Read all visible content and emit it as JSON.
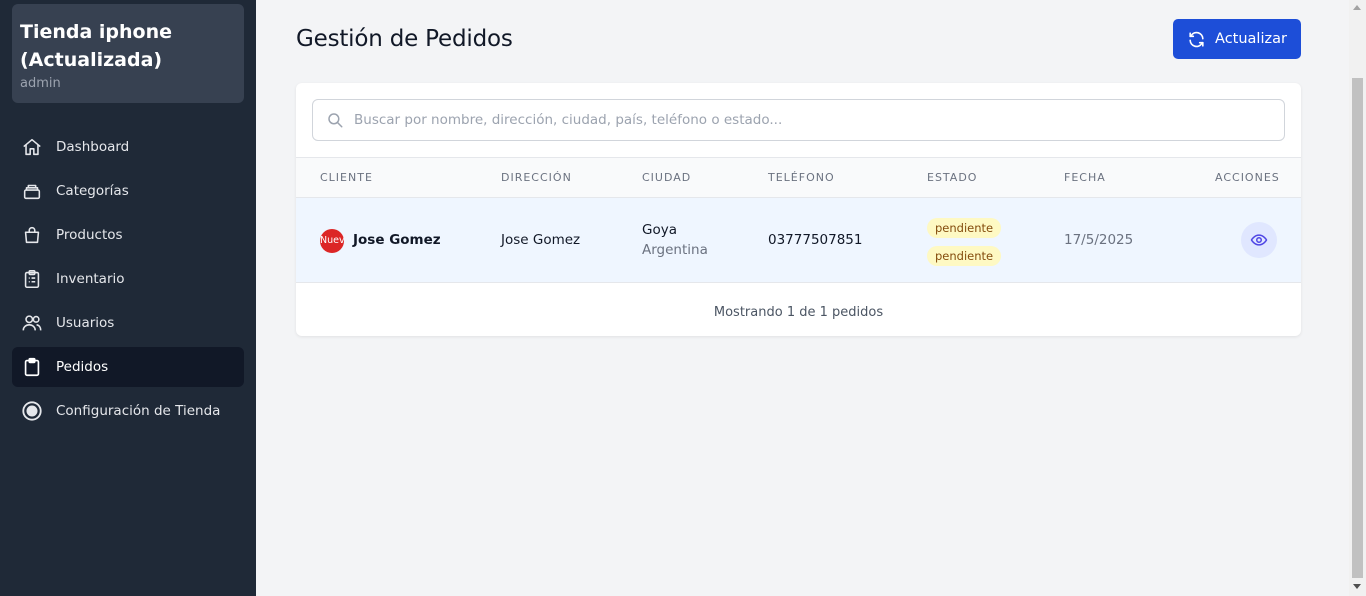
{
  "sidebar": {
    "store_title": "Tienda iphone (Actualizada)",
    "store_role": "admin",
    "items": [
      {
        "label": "Dashboard",
        "icon": "home-icon"
      },
      {
        "label": "Categorías",
        "icon": "layers-icon"
      },
      {
        "label": "Productos",
        "icon": "bag-icon"
      },
      {
        "label": "Inventario",
        "icon": "clipboard-list-icon"
      },
      {
        "label": "Usuarios",
        "icon": "users-icon"
      },
      {
        "label": "Pedidos",
        "icon": "clipboard-icon",
        "active": true
      },
      {
        "label": "Configuración de Tienda",
        "icon": "target-icon"
      }
    ]
  },
  "header": {
    "title": "Gestión de Pedidos",
    "refresh_label": "Actualizar"
  },
  "search": {
    "placeholder": "Buscar por nombre, dirección, ciudad, país, teléfono o estado..."
  },
  "table": {
    "columns": [
      "Cliente",
      "Dirección",
      "Ciudad",
      "Teléfono",
      "Estado",
      "Fecha",
      "Acciones"
    ],
    "rows": [
      {
        "new_badge": "Nuevo",
        "client": "Jose Gomez",
        "address": "Jose Gomez",
        "city": "Goya",
        "country": "Argentina",
        "phone": "03777507851",
        "status": [
          "pendiente",
          "pendiente"
        ],
        "date": "17/5/2025"
      }
    ]
  },
  "footer": {
    "summary": "Mostrando 1 de 1 pedidos"
  },
  "colors": {
    "sidebar_bg": "#1f2937",
    "active_item_bg": "#111827",
    "primary": "#1d4ed8",
    "status_bg": "#fef9c3",
    "new_badge": "#dc2626"
  }
}
